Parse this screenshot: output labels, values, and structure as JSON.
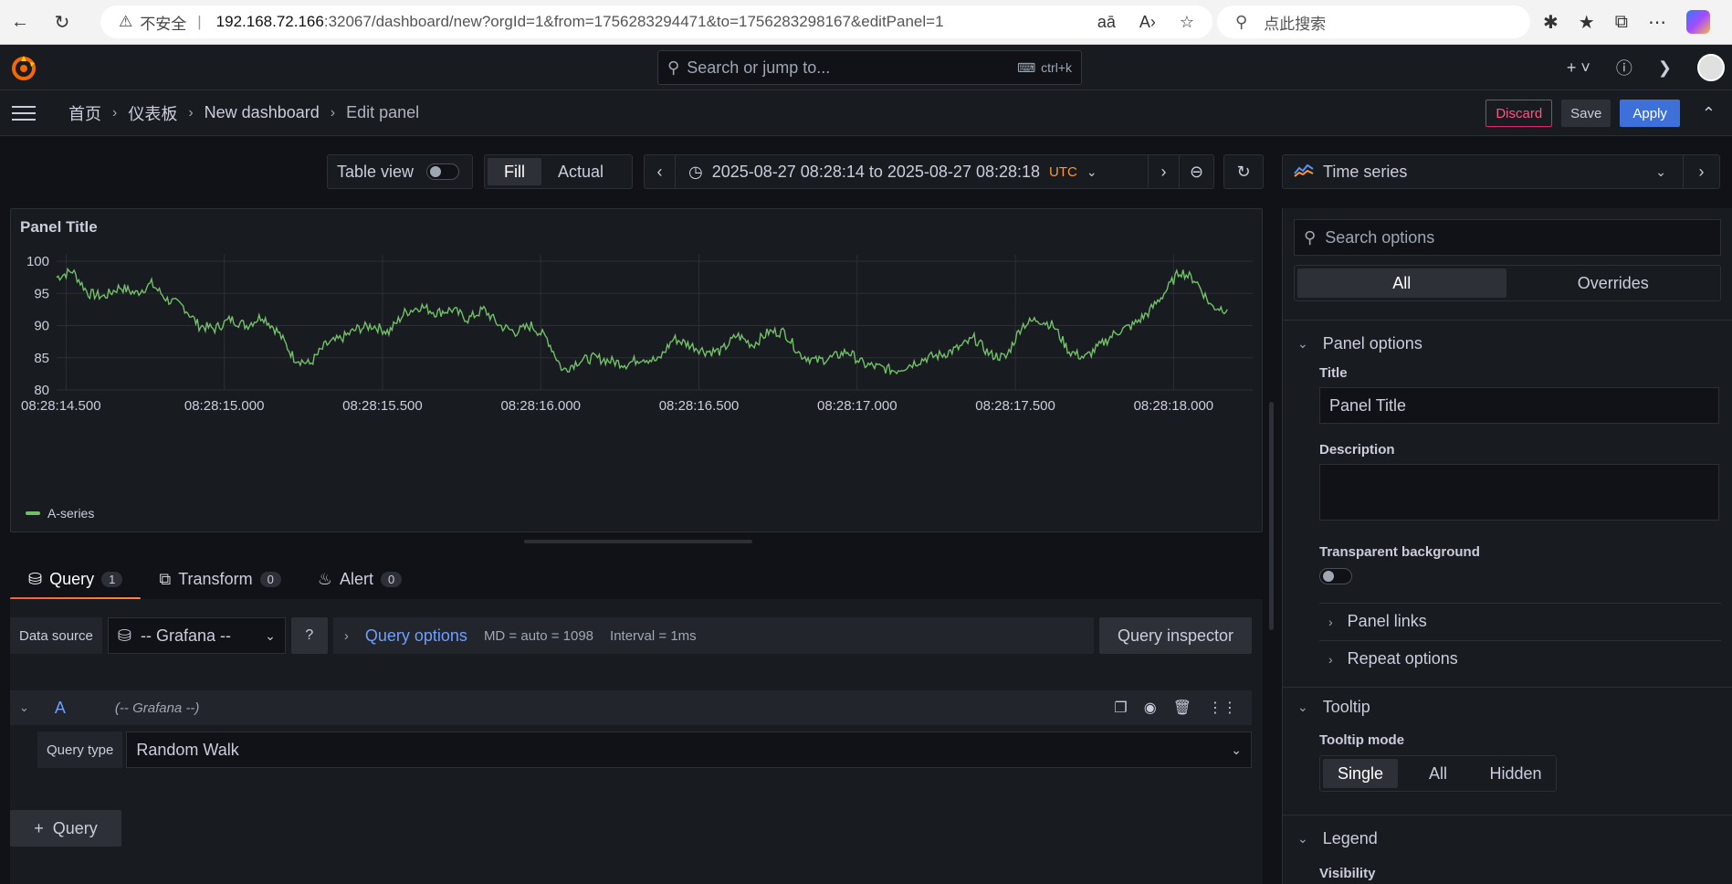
{
  "browser": {
    "insecure_label": "不安全",
    "url_host": "192.168.72.166",
    "url_path": ":32067/dashboard/new?orgId=1&from=1756283294471&to=1756283298167&editPanel=1",
    "search_placeholder": "点此搜索"
  },
  "topbar": {
    "search_placeholder": "Search or jump to...",
    "shortcut": "ctrl+k"
  },
  "breadcrumbs": {
    "home": "首页",
    "dashboards": "仪表板",
    "dashboard": "New dashboard",
    "current": "Edit panel"
  },
  "actions": {
    "discard": "Discard",
    "save": "Save",
    "apply": "Apply"
  },
  "toolbar": {
    "table_view": "Table view",
    "fill": "Fill",
    "actual": "Actual",
    "time_range": "2025-08-27 08:28:14 to 2025-08-27 08:28:18",
    "timezone": "UTC"
  },
  "viz": {
    "name": "Time series"
  },
  "panel": {
    "title": "Panel Title"
  },
  "chart_data": {
    "type": "line",
    "title": "Panel Title",
    "xlabel": "",
    "ylabel": "",
    "ylim": [
      80,
      101
    ],
    "y_ticks": [
      80,
      85,
      90,
      95,
      100
    ],
    "x_ticks": [
      "08:28:14.500",
      "08:28:15.000",
      "08:28:15.500",
      "08:28:16.000",
      "08:28:16.500",
      "08:28:17.000",
      "08:28:17.500",
      "08:28:18.000"
    ],
    "grid": true,
    "legend": "bottom-left",
    "series": [
      {
        "name": "A-series",
        "color": "#73bf69",
        "x": [
          14.47,
          14.52,
          14.57,
          14.62,
          14.67,
          14.72,
          14.77,
          14.82,
          14.87,
          14.92,
          14.97,
          15.02,
          15.07,
          15.12,
          15.17,
          15.22,
          15.27,
          15.32,
          15.37,
          15.42,
          15.47,
          15.52,
          15.57,
          15.62,
          15.67,
          15.72,
          15.77,
          15.82,
          15.87,
          15.92,
          15.97,
          16.02,
          16.07,
          16.12,
          16.17,
          16.22,
          16.27,
          16.32,
          16.37,
          16.42,
          16.47,
          16.52,
          16.57,
          16.62,
          16.67,
          16.72,
          16.77,
          16.82,
          16.87,
          16.92,
          16.97,
          17.02,
          17.07,
          17.12,
          17.17,
          17.22,
          17.27,
          17.32,
          17.37,
          17.42,
          17.47,
          17.52,
          17.57,
          17.62,
          17.67,
          17.72,
          17.77,
          17.82,
          17.87,
          17.92,
          17.97,
          18.02,
          18.07,
          18.12,
          18.17
        ],
        "values": [
          97.5,
          98.5,
          95,
          94.5,
          96,
          95,
          96.5,
          94,
          93,
          90,
          89.5,
          91,
          90,
          91.5,
          89,
          85,
          84,
          87,
          88,
          89.5,
          90,
          89,
          92,
          93,
          92,
          92.5,
          91,
          92.5,
          90,
          89,
          90,
          88,
          83,
          84.5,
          85,
          84.5,
          84,
          85,
          84.5,
          88,
          87,
          86,
          86,
          88.5,
          87,
          89,
          89,
          85.5,
          84.5,
          85,
          86,
          84,
          83.5,
          83,
          84,
          85,
          85.5,
          86.5,
          88,
          85.5,
          85,
          90,
          91,
          90,
          86,
          85,
          87,
          89,
          90,
          92,
          95,
          98.5,
          97,
          93,
          92.5
        ]
      }
    ]
  },
  "query_tabs": [
    {
      "label": "Query",
      "count": "1"
    },
    {
      "label": "Transform",
      "count": "0"
    },
    {
      "label": "Alert",
      "count": "0"
    }
  ],
  "query": {
    "ds_label": "Data source",
    "ds_value": "-- Grafana --",
    "options_title": "Query options",
    "md": "MD = auto = 1098",
    "interval": "Interval = 1ms",
    "inspector": "Query inspector",
    "row_name": "A",
    "row_ds": "(-- Grafana --)",
    "type_label": "Query type",
    "type_value": "Random Walk",
    "add": "Query"
  },
  "options": {
    "search_placeholder": "Search options",
    "tab_all": "All",
    "tab_overrides": "Overrides",
    "panel_options": "Panel options",
    "title_label": "Title",
    "title_value": "Panel Title",
    "description_label": "Description",
    "transparent_label": "Transparent background",
    "panel_links": "Panel links",
    "repeat_options": "Repeat options",
    "tooltip": "Tooltip",
    "tooltip_mode": "Tooltip mode",
    "tm_single": "Single",
    "tm_all": "All",
    "tm_hidden": "Hidden",
    "legend": "Legend",
    "visibility": "Visibility"
  }
}
